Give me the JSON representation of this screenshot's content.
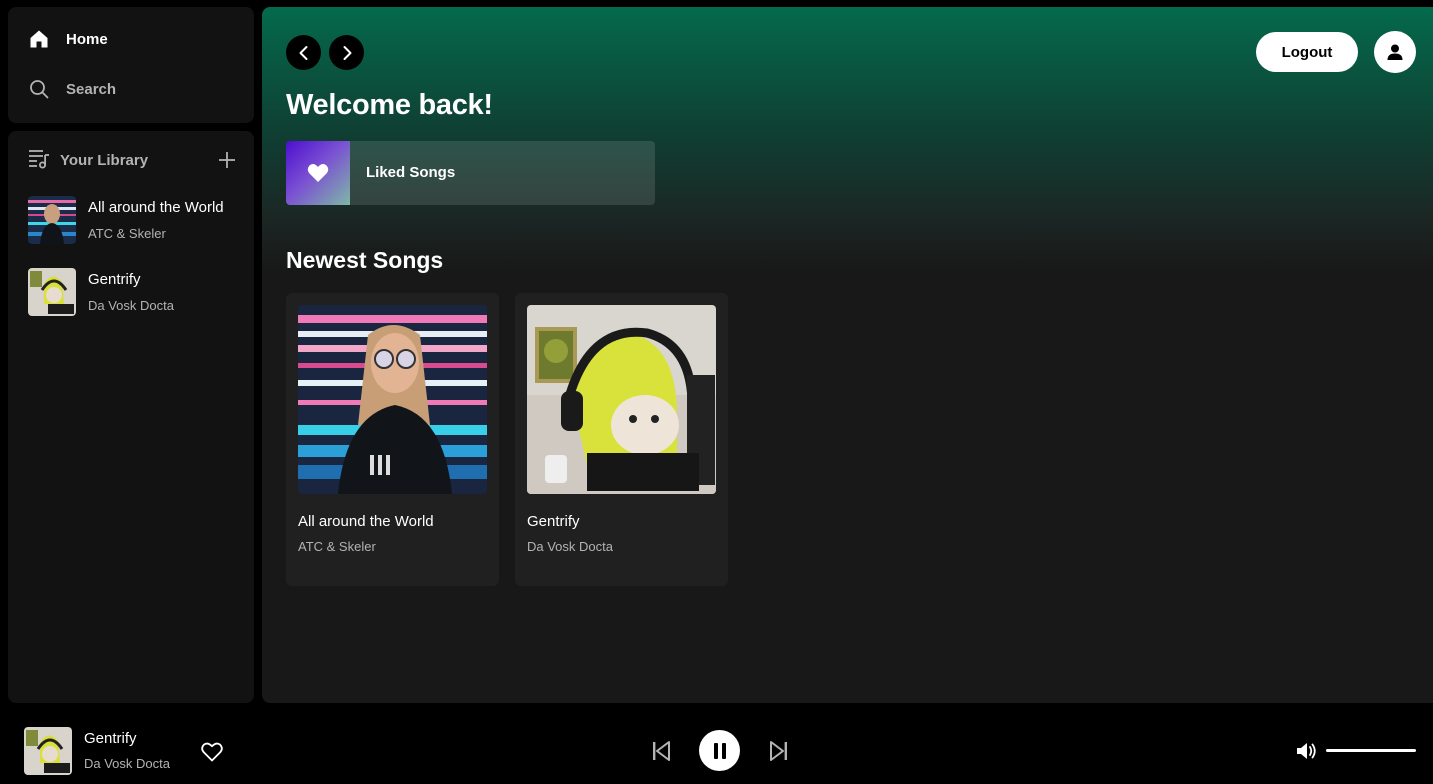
{
  "nav": {
    "home_label": "Home",
    "search_label": "Search"
  },
  "library": {
    "title": "Your Library",
    "items": [
      {
        "title": "All around the World",
        "artist": "ATC & Skeler"
      },
      {
        "title": "Gentrify",
        "artist": "Da Vosk Docta"
      }
    ]
  },
  "header": {
    "logout_label": "Logout"
  },
  "main": {
    "welcome": "Welcome back!",
    "liked_songs_label": "Liked Songs",
    "section_title": "Newest Songs",
    "songs": [
      {
        "title": "All around the World",
        "artist": "ATC & Skeler"
      },
      {
        "title": "Gentrify",
        "artist": "Da Vosk Docta"
      }
    ]
  },
  "player": {
    "title": "Gentrify",
    "artist": "Da Vosk Docta",
    "state": "playing",
    "volume": 1.0
  },
  "colors": {
    "accent_gradient_top": "#046a4c",
    "background": "#121212",
    "card": "#202020"
  }
}
